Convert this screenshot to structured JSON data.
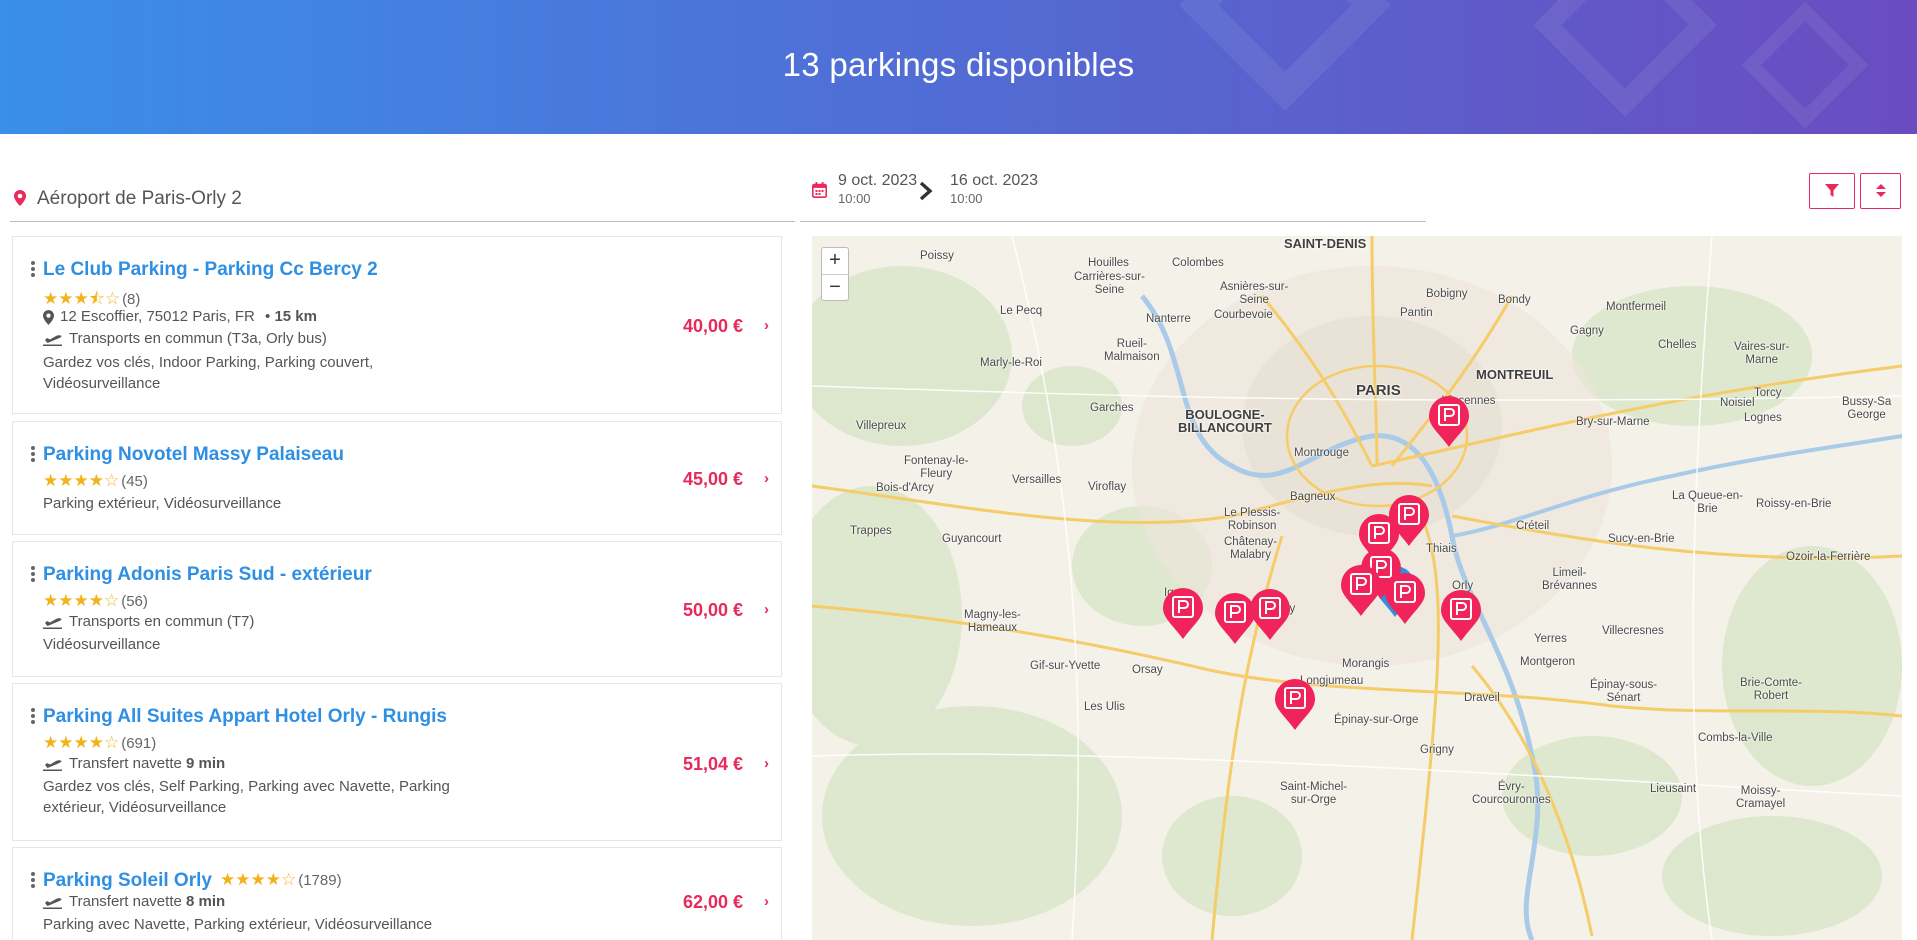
{
  "header": {
    "title": "13 parkings disponibles"
  },
  "search": {
    "location": "Aéroport de Paris-Orly 2",
    "start_date": "9 oct. 2023",
    "start_time": "10:00",
    "end_date": "16 oct. 2023",
    "end_time": "10:00"
  },
  "colors": {
    "accent": "#e8295a",
    "link": "#2f8fe3",
    "star": "#f3b21b"
  },
  "results": [
    {
      "name": "Le Club Parking - Parking Cc Bercy 2",
      "stars": "★★★⯪☆",
      "reviews": "(8)",
      "address": "12 Escoffier, 75012 Paris, FR",
      "distance": "15 km",
      "transport": "Transports en commun (T3a, Orly bus)",
      "amenities": "Gardez vos clés, Indoor Parking, Parking couvert, Vidéosurveillance",
      "price": "40,00 €"
    },
    {
      "name": "Parking Novotel Massy Palaiseau",
      "stars": "★★★★☆",
      "reviews": "(45)",
      "amenities": "Parking extérieur, Vidéosurveillance",
      "price": "45,00 €"
    },
    {
      "name": "Parking Adonis Paris Sud - extérieur",
      "stars": "★★★★☆",
      "reviews": "(56)",
      "transport": "Transports en commun (T7)",
      "amenities": "Vidéosurveillance",
      "price": "50,00 €"
    },
    {
      "name": "Parking All Suites Appart Hotel Orly - Rungis",
      "stars": "★★★★☆",
      "reviews": "(691)",
      "transport_label": "Transfert navette",
      "transport_time": "9 min",
      "amenities": "Gardez vos clés, Self Parking, Parking avec Navette, Parking extérieur, Vidéosurveillance",
      "price": "51,04 €"
    },
    {
      "name": "Parking Soleil Orly",
      "stars": "★★★★☆",
      "reviews": "(1789)",
      "transport_label": "Transfert navette",
      "transport_time": "8 min",
      "amenities": "Parking avec Navette, Parking extérieur, Vidéosurveillance",
      "price": "62,00 €"
    }
  ],
  "map": {
    "zoom_in": "+",
    "zoom_out": "−",
    "places": [
      {
        "id": "saint-denis",
        "label": "SAINT-DENIS",
        "cls": "mid"
      },
      {
        "id": "poissy",
        "label": "Poissy"
      },
      {
        "id": "houilles",
        "label": "Houilles"
      },
      {
        "id": "colombes",
        "label": "Colombes"
      },
      {
        "id": "carrieres",
        "label": "Carrières-sur-\nSeine"
      },
      {
        "id": "asnieres",
        "label": "Asnières-sur-\nSeine"
      },
      {
        "id": "bobigny",
        "label": "Bobigny"
      },
      {
        "id": "bondy",
        "label": "Bondy"
      },
      {
        "id": "pantin",
        "label": "Pantin"
      },
      {
        "id": "montfermeil",
        "label": "Montfermeil"
      },
      {
        "id": "lepecq",
        "label": "Le Pecq"
      },
      {
        "id": "nanterre",
        "label": "Nanterre"
      },
      {
        "id": "courbevoie",
        "label": "Courbevoie"
      },
      {
        "id": "gagny",
        "label": "Gagny"
      },
      {
        "id": "rueil",
        "label": "Rueil-\nMalmaison"
      },
      {
        "id": "chelles",
        "label": "Chelles"
      },
      {
        "id": "vaires",
        "label": "Vaires-sur-\nMarne"
      },
      {
        "id": "marly",
        "label": "Marly-le-Roi"
      },
      {
        "id": "montreuil",
        "label": "MONTREUIL",
        "cls": "mid"
      },
      {
        "id": "paris",
        "label": "PARIS",
        "cls": "big"
      },
      {
        "id": "torcy",
        "label": "Torcy"
      },
      {
        "id": "bussy",
        "label": "Bussy-Sa\nGeorge"
      },
      {
        "id": "garches",
        "label": "Garches"
      },
      {
        "id": "boulogne",
        "label": "BOULOGNE-\nBILLANCOURT",
        "cls": "mid"
      },
      {
        "id": "vincennes",
        "label": "Vincennes"
      },
      {
        "id": "noisiel",
        "label": "Noisiel"
      },
      {
        "id": "lognes",
        "label": "Lognes"
      },
      {
        "id": "villepreux",
        "label": "Villepreux"
      },
      {
        "id": "bry",
        "label": "Bry-sur-Marne"
      },
      {
        "id": "montrouge",
        "label": "Montrouge"
      },
      {
        "id": "fontenay",
        "label": "Fontenay-le-\nFleury"
      },
      {
        "id": "versailles",
        "label": "Versailles"
      },
      {
        "id": "boisdarcy",
        "label": "Bois-d'Arcy"
      },
      {
        "id": "viroflay",
        "label": "Viroflay"
      },
      {
        "id": "bagneux",
        "label": "Bagneux"
      },
      {
        "id": "laqueue",
        "label": "La Queue-en-\nBrie"
      },
      {
        "id": "roissy",
        "label": "Roissy-en-Brie"
      },
      {
        "id": "plessis",
        "label": "Le Plessis-\nRobinson"
      },
      {
        "id": "trappes",
        "label": "Trappes"
      },
      {
        "id": "guyancourt",
        "label": "Guyancourt"
      },
      {
        "id": "creteil",
        "label": "Créteil"
      },
      {
        "id": "thiais",
        "label": "Thiais"
      },
      {
        "id": "chatenay",
        "label": "Châtenay-\nMalabry"
      },
      {
        "id": "sucy",
        "label": "Sucy-en-Brie"
      },
      {
        "id": "ozoir",
        "label": "Ozoir-la-Ferrière"
      },
      {
        "id": "limeil",
        "label": "Limeil-\nBrévannes"
      },
      {
        "id": "igny",
        "label": "Igny"
      },
      {
        "id": "orly",
        "label": "Orly"
      },
      {
        "id": "massy",
        "label": "Massy"
      },
      {
        "id": "magny",
        "label": "Magny-les-\nHameaux"
      },
      {
        "id": "villecresnes",
        "label": "Villecresnes"
      },
      {
        "id": "yerres",
        "label": "Yerres"
      },
      {
        "id": "gif",
        "label": "Gif-sur-Yvette"
      },
      {
        "id": "orsay",
        "label": "Orsay"
      },
      {
        "id": "morangis",
        "label": "Morangis"
      },
      {
        "id": "montgeron",
        "label": "Montgeron"
      },
      {
        "id": "longjumeau",
        "label": "Longjumeau"
      },
      {
        "id": "epinaysenart",
        "label": "Épinay-sous-\nSénart"
      },
      {
        "id": "brie",
        "label": "Brie-Comte-\nRobert"
      },
      {
        "id": "draveil",
        "label": "Draveil"
      },
      {
        "id": "lesulis",
        "label": "Les Ulis"
      },
      {
        "id": "epinayorge",
        "label": "Épinay-sur-Orge"
      },
      {
        "id": "combs",
        "label": "Combs-la-Ville"
      },
      {
        "id": "grigny",
        "label": "Grigny"
      },
      {
        "id": "stmichel",
        "label": "Saint-Michel-\nsur-Orge"
      },
      {
        "id": "evry",
        "label": "Évry-\nCourcouronnes"
      },
      {
        "id": "lieusaint",
        "label": "Lieusaint"
      },
      {
        "id": "moissy",
        "label": "Moissy-\nCramayel"
      }
    ]
  }
}
